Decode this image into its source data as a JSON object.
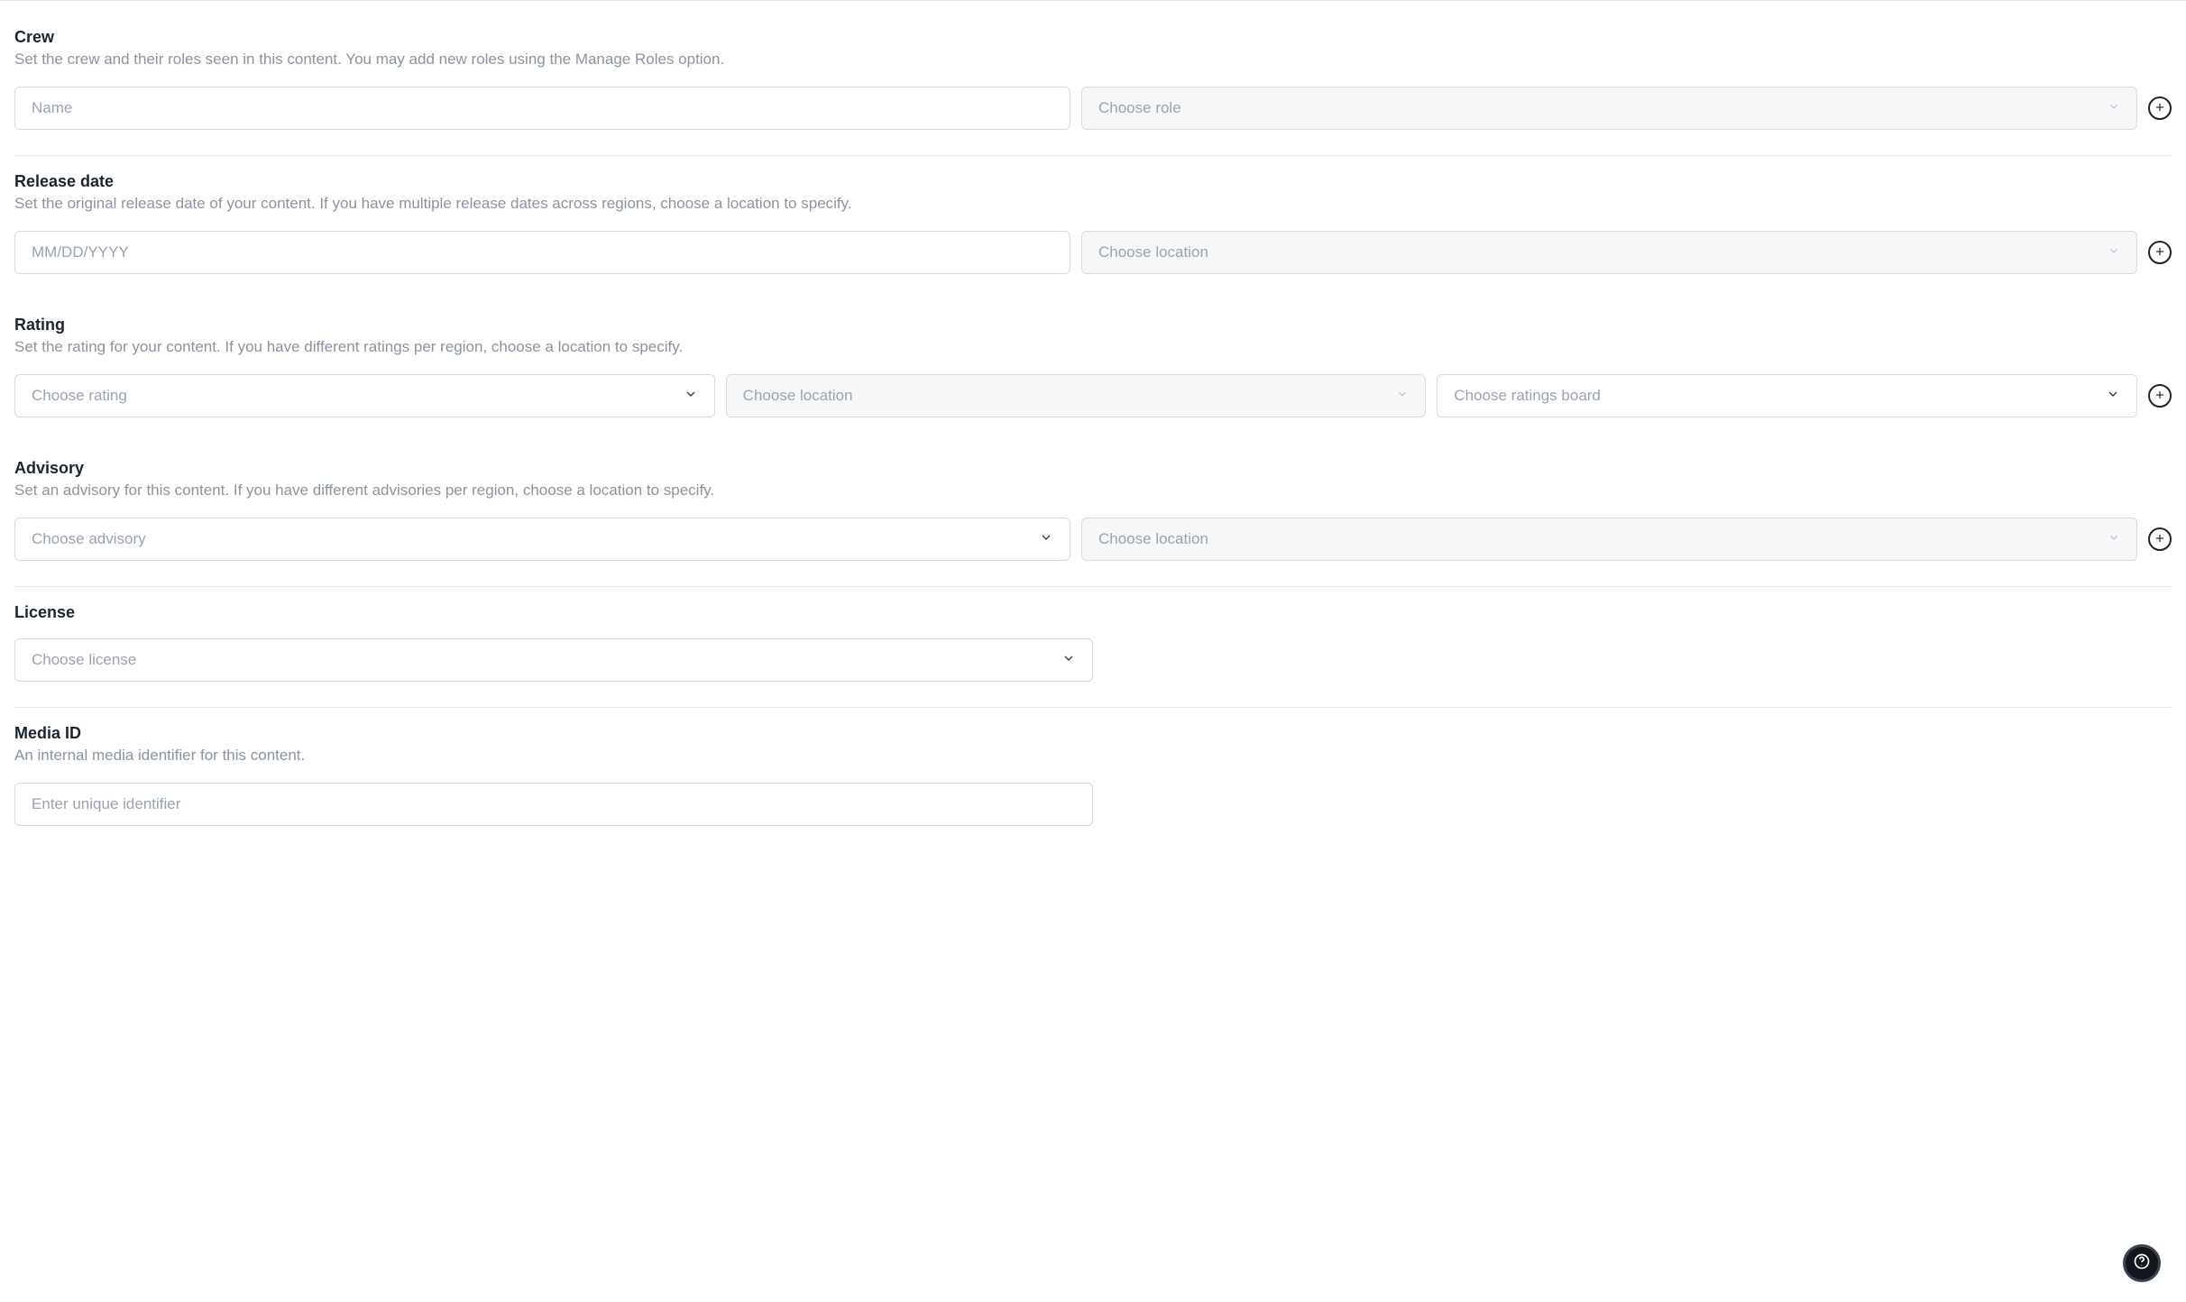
{
  "crew": {
    "title": "Crew",
    "desc": "Set the crew and their roles seen in this content. You may add new roles using the Manage Roles option.",
    "name_placeholder": "Name",
    "role_placeholder": "Choose role"
  },
  "release": {
    "title": "Release date",
    "desc": "Set the original release date of your content. If you have multiple release dates across regions, choose a location to specify.",
    "date_placeholder": "MM/DD/YYYY",
    "location_placeholder": "Choose location"
  },
  "rating": {
    "title": "Rating",
    "desc": "Set the rating for your content. If you have different ratings per region, choose a location to specify.",
    "rating_placeholder": "Choose rating",
    "location_placeholder": "Choose location",
    "board_placeholder": "Choose ratings board"
  },
  "advisory": {
    "title": "Advisory",
    "desc": "Set an advisory for this content. If you have different advisories per region, choose a location to specify.",
    "advisory_placeholder": "Choose advisory",
    "location_placeholder": "Choose location"
  },
  "license": {
    "title": "License",
    "license_placeholder": "Choose license"
  },
  "media_id": {
    "title": "Media ID",
    "desc": "An internal media identifier for this content.",
    "placeholder": "Enter unique identifier"
  }
}
